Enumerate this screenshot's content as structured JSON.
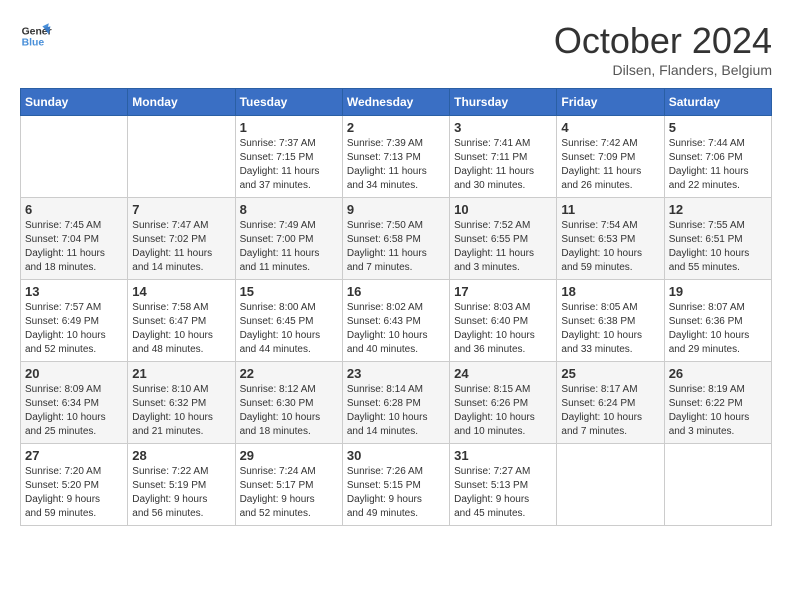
{
  "header": {
    "logo_line1": "General",
    "logo_line2": "Blue",
    "month": "October 2024",
    "location": "Dilsen, Flanders, Belgium"
  },
  "days_of_week": [
    "Sunday",
    "Monday",
    "Tuesday",
    "Wednesday",
    "Thursday",
    "Friday",
    "Saturday"
  ],
  "weeks": [
    [
      {
        "day": "",
        "info": ""
      },
      {
        "day": "",
        "info": ""
      },
      {
        "day": "1",
        "info": "Sunrise: 7:37 AM\nSunset: 7:15 PM\nDaylight: 11 hours\nand 37 minutes."
      },
      {
        "day": "2",
        "info": "Sunrise: 7:39 AM\nSunset: 7:13 PM\nDaylight: 11 hours\nand 34 minutes."
      },
      {
        "day": "3",
        "info": "Sunrise: 7:41 AM\nSunset: 7:11 PM\nDaylight: 11 hours\nand 30 minutes."
      },
      {
        "day": "4",
        "info": "Sunrise: 7:42 AM\nSunset: 7:09 PM\nDaylight: 11 hours\nand 26 minutes."
      },
      {
        "day": "5",
        "info": "Sunrise: 7:44 AM\nSunset: 7:06 PM\nDaylight: 11 hours\nand 22 minutes."
      }
    ],
    [
      {
        "day": "6",
        "info": "Sunrise: 7:45 AM\nSunset: 7:04 PM\nDaylight: 11 hours\nand 18 minutes."
      },
      {
        "day": "7",
        "info": "Sunrise: 7:47 AM\nSunset: 7:02 PM\nDaylight: 11 hours\nand 14 minutes."
      },
      {
        "day": "8",
        "info": "Sunrise: 7:49 AM\nSunset: 7:00 PM\nDaylight: 11 hours\nand 11 minutes."
      },
      {
        "day": "9",
        "info": "Sunrise: 7:50 AM\nSunset: 6:58 PM\nDaylight: 11 hours\nand 7 minutes."
      },
      {
        "day": "10",
        "info": "Sunrise: 7:52 AM\nSunset: 6:55 PM\nDaylight: 11 hours\nand 3 minutes."
      },
      {
        "day": "11",
        "info": "Sunrise: 7:54 AM\nSunset: 6:53 PM\nDaylight: 10 hours\nand 59 minutes."
      },
      {
        "day": "12",
        "info": "Sunrise: 7:55 AM\nSunset: 6:51 PM\nDaylight: 10 hours\nand 55 minutes."
      }
    ],
    [
      {
        "day": "13",
        "info": "Sunrise: 7:57 AM\nSunset: 6:49 PM\nDaylight: 10 hours\nand 52 minutes."
      },
      {
        "day": "14",
        "info": "Sunrise: 7:58 AM\nSunset: 6:47 PM\nDaylight: 10 hours\nand 48 minutes."
      },
      {
        "day": "15",
        "info": "Sunrise: 8:00 AM\nSunset: 6:45 PM\nDaylight: 10 hours\nand 44 minutes."
      },
      {
        "day": "16",
        "info": "Sunrise: 8:02 AM\nSunset: 6:43 PM\nDaylight: 10 hours\nand 40 minutes."
      },
      {
        "day": "17",
        "info": "Sunrise: 8:03 AM\nSunset: 6:40 PM\nDaylight: 10 hours\nand 36 minutes."
      },
      {
        "day": "18",
        "info": "Sunrise: 8:05 AM\nSunset: 6:38 PM\nDaylight: 10 hours\nand 33 minutes."
      },
      {
        "day": "19",
        "info": "Sunrise: 8:07 AM\nSunset: 6:36 PM\nDaylight: 10 hours\nand 29 minutes."
      }
    ],
    [
      {
        "day": "20",
        "info": "Sunrise: 8:09 AM\nSunset: 6:34 PM\nDaylight: 10 hours\nand 25 minutes."
      },
      {
        "day": "21",
        "info": "Sunrise: 8:10 AM\nSunset: 6:32 PM\nDaylight: 10 hours\nand 21 minutes."
      },
      {
        "day": "22",
        "info": "Sunrise: 8:12 AM\nSunset: 6:30 PM\nDaylight: 10 hours\nand 18 minutes."
      },
      {
        "day": "23",
        "info": "Sunrise: 8:14 AM\nSunset: 6:28 PM\nDaylight: 10 hours\nand 14 minutes."
      },
      {
        "day": "24",
        "info": "Sunrise: 8:15 AM\nSunset: 6:26 PM\nDaylight: 10 hours\nand 10 minutes."
      },
      {
        "day": "25",
        "info": "Sunrise: 8:17 AM\nSunset: 6:24 PM\nDaylight: 10 hours\nand 7 minutes."
      },
      {
        "day": "26",
        "info": "Sunrise: 8:19 AM\nSunset: 6:22 PM\nDaylight: 10 hours\nand 3 minutes."
      }
    ],
    [
      {
        "day": "27",
        "info": "Sunrise: 7:20 AM\nSunset: 5:20 PM\nDaylight: 9 hours\nand 59 minutes."
      },
      {
        "day": "28",
        "info": "Sunrise: 7:22 AM\nSunset: 5:19 PM\nDaylight: 9 hours\nand 56 minutes."
      },
      {
        "day": "29",
        "info": "Sunrise: 7:24 AM\nSunset: 5:17 PM\nDaylight: 9 hours\nand 52 minutes."
      },
      {
        "day": "30",
        "info": "Sunrise: 7:26 AM\nSunset: 5:15 PM\nDaylight: 9 hours\nand 49 minutes."
      },
      {
        "day": "31",
        "info": "Sunrise: 7:27 AM\nSunset: 5:13 PM\nDaylight: 9 hours\nand 45 minutes."
      },
      {
        "day": "",
        "info": ""
      },
      {
        "day": "",
        "info": ""
      }
    ]
  ]
}
